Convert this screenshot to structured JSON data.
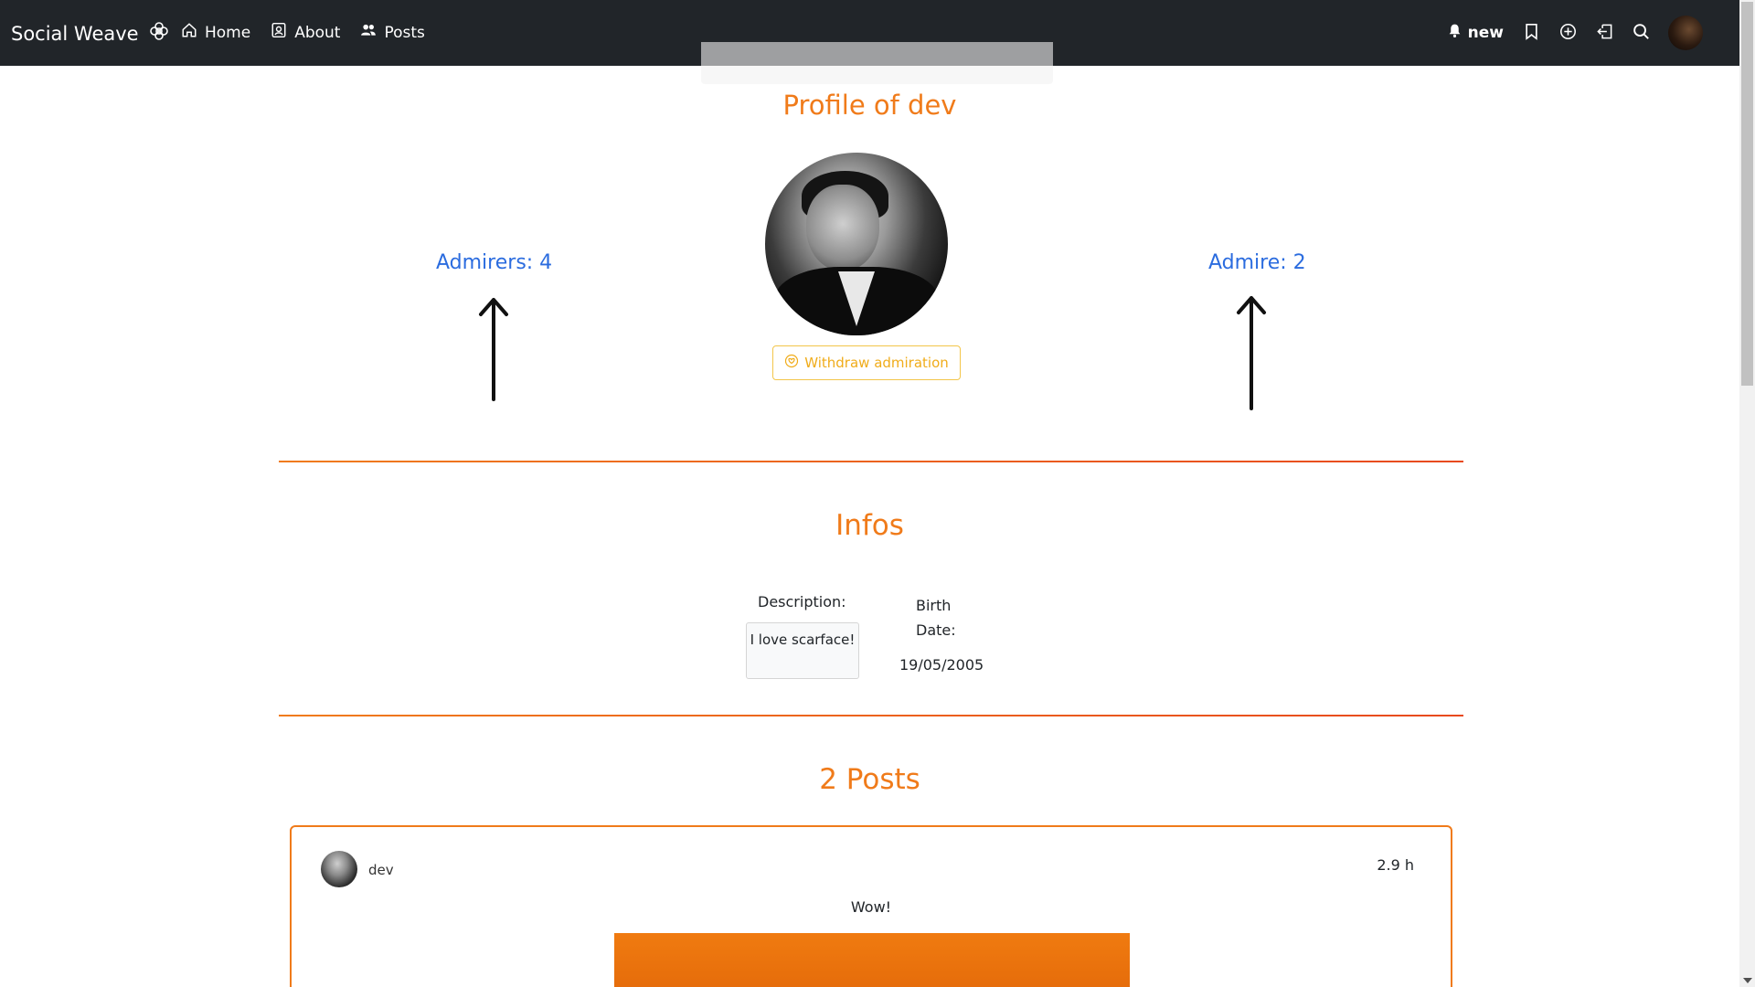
{
  "navbar": {
    "brand": "Social Weave",
    "links": [
      {
        "label": "Home",
        "icon": "house-icon"
      },
      {
        "label": "About",
        "icon": "person-badge-icon"
      },
      {
        "label": "Posts",
        "icon": "people-icon"
      }
    ],
    "notification_label": "new"
  },
  "profile": {
    "title": "Profile of dev",
    "admirers_label": "Admirers: 4",
    "admire_label": "Admire: 2",
    "withdraw_label": "Withdraw admiration"
  },
  "infos": {
    "title": "Infos",
    "description_label": "Description:",
    "description_value": "I love scarface!",
    "birth_label": "Birth Date:",
    "birth_value": "19/05/2005"
  },
  "posts": {
    "title": "2 Posts",
    "items": [
      {
        "author": "dev",
        "time": "2.9 h",
        "text": "Wow!"
      }
    ]
  },
  "colors": {
    "navbar_bg": "#212529",
    "accent_orange": "#f07b1a",
    "link_blue": "#2b6cdf",
    "withdraw_yellow": "#f0ac1a"
  }
}
